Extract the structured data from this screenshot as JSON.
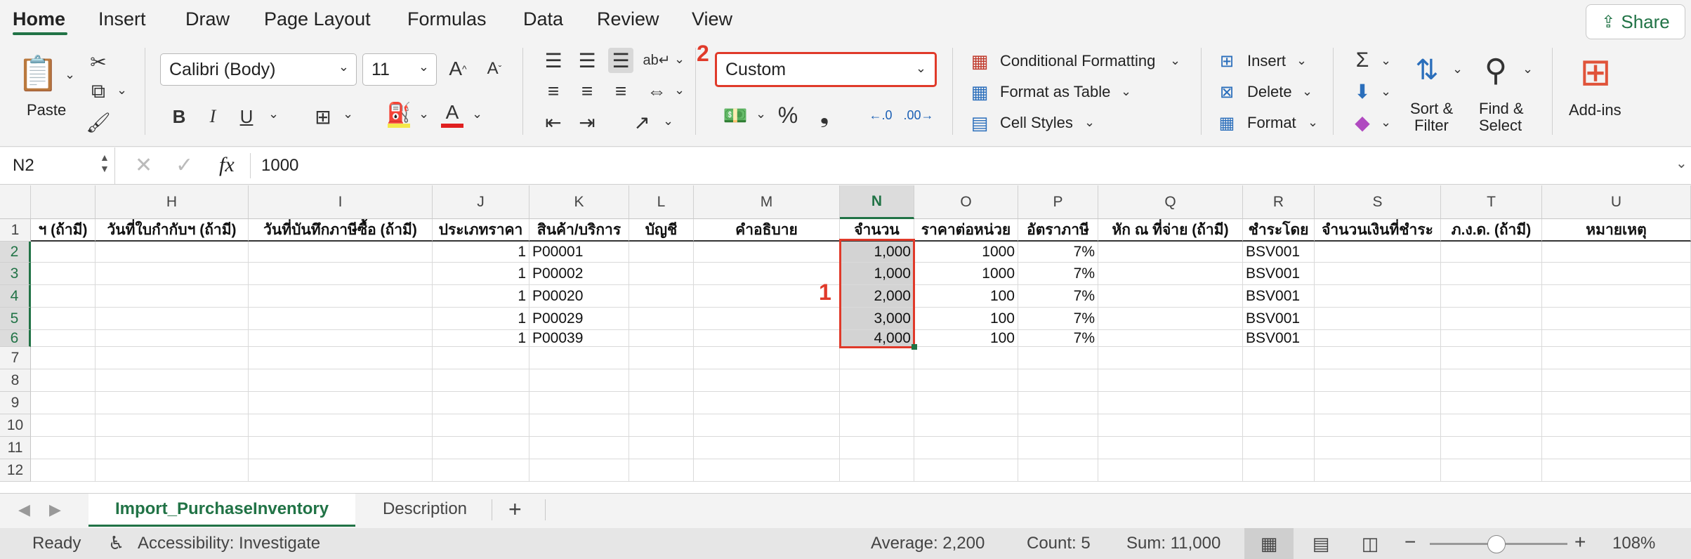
{
  "menu": {
    "tabs": [
      "Home",
      "Insert",
      "Draw",
      "Page Layout",
      "Formulas",
      "Data",
      "Review",
      "View"
    ],
    "share_label": "Share"
  },
  "ribbon": {
    "paste_label": "Paste",
    "font_name": "Calibri (Body)",
    "font_size": "11",
    "bold": "B",
    "italic": "I",
    "underline": "U",
    "number_format": "Custom",
    "percent": "%",
    "comma": "❟",
    "dec_increase": ".0",
    "dec_decrease": ".00",
    "conditional_formatting": "Conditional Formatting",
    "format_as_table": "Format as Table",
    "cell_styles": "Cell Styles",
    "insert": "Insert",
    "delete": "Delete",
    "format": "Format",
    "sort_filter_1": "Sort &",
    "sort_filter_2": "Filter",
    "find_select_1": "Find &",
    "find_select_2": "Select",
    "addins": "Add-ins",
    "annotation_2": "2"
  },
  "formula_bar": {
    "name_box": "N2",
    "fx": "fx",
    "value": "1000"
  },
  "grid": {
    "annotation_1": "1",
    "columns": [
      "",
      "H",
      "I",
      "J",
      "K",
      "L",
      "M",
      "N",
      "O",
      "P",
      "Q",
      "R",
      "S",
      "T",
      "U"
    ],
    "rows": [
      "1",
      "2",
      "3",
      "4",
      "5",
      "6",
      "7",
      "8",
      "9",
      "10",
      "11",
      "12"
    ],
    "header_row": [
      "ฯ (ถ้ามี)",
      "วันที่ใบกำกับฯ (ถ้ามี)",
      "วันที่บันทึกภาษีซื้อ (ถ้ามี)",
      "ประเภทราคา",
      "สินค้า/บริการ",
      "บัญชี",
      "คำอธิบาย",
      "จำนวน",
      "ราคาต่อหน่วย",
      "อัตราภาษี",
      "หัก ณ ที่จ่าย (ถ้ามี)",
      "ชำระโดย",
      "จำนวนเงินที่ชำระ",
      "ภ.ง.ด. (ถ้ามี)",
      "หมายเหตุ"
    ],
    "data_rows": [
      [
        "",
        "",
        "",
        "1",
        "P00001",
        "",
        "",
        "1,000",
        "1000",
        "7%",
        "",
        "BSV001",
        "",
        "",
        ""
      ],
      [
        "",
        "",
        "",
        "1",
        "P00002",
        "",
        "",
        "1,000",
        "1000",
        "7%",
        "",
        "BSV001",
        "",
        "",
        ""
      ],
      [
        "",
        "",
        "",
        "1",
        "P00020",
        "",
        "",
        "2,000",
        "100",
        "7%",
        "",
        "BSV001",
        "",
        "",
        ""
      ],
      [
        "",
        "",
        "",
        "1",
        "P00029",
        "",
        "",
        "3,000",
        "100",
        "7%",
        "",
        "BSV001",
        "",
        "",
        ""
      ],
      [
        "",
        "",
        "",
        "1",
        "P00039",
        "",
        "",
        "4,000",
        "100",
        "7%",
        "",
        "BSV001",
        "",
        "",
        ""
      ]
    ]
  },
  "sheets": {
    "tabs": [
      "Import_PurchaseInventory",
      "Description"
    ],
    "add": "+"
  },
  "status": {
    "ready": "Ready",
    "accessibility": "Accessibility: Investigate",
    "average": "Average:  2,200",
    "count": "Count: 5",
    "sum": "Sum: 11,000",
    "zoom": "108%"
  },
  "colors": {
    "accent": "#217346",
    "annotation": "#e03a2a",
    "selection_fill": "#d3d3d3"
  }
}
